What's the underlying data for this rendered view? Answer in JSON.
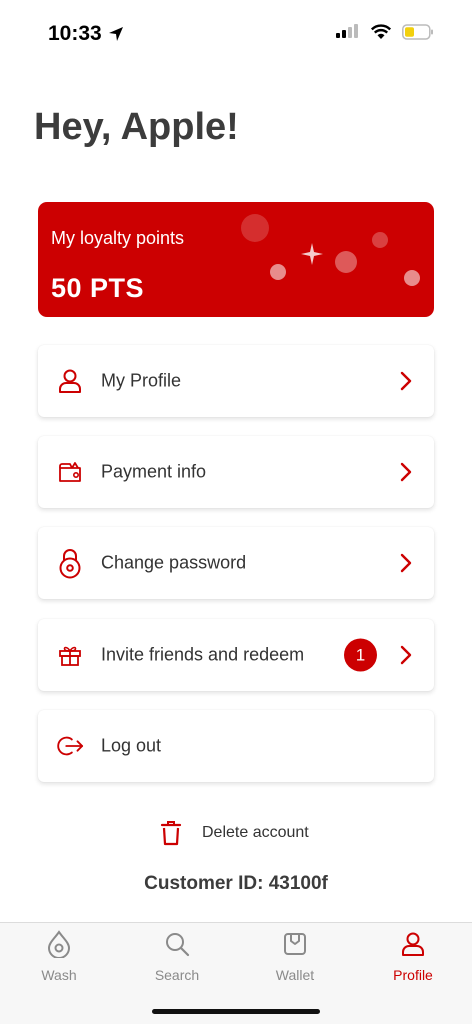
{
  "status": {
    "time": "10:33"
  },
  "greeting": "Hey, Apple!",
  "loyalty": {
    "label": "My loyalty points",
    "points": "50 PTS"
  },
  "menu": [
    {
      "label": "My Profile",
      "icon": "user-icon"
    },
    {
      "label": "Payment info",
      "icon": "wallet-icon"
    },
    {
      "label": "Change password",
      "icon": "lock-icon"
    },
    {
      "label": "Invite friends and redeem",
      "icon": "gift-icon",
      "badge": "1"
    },
    {
      "label": "Log out",
      "icon": "logout-icon"
    }
  ],
  "delete_account": "Delete account",
  "customer_id": "Customer ID: 43100f",
  "tabs": [
    {
      "label": "Wash",
      "icon": "drop-icon"
    },
    {
      "label": "Search",
      "icon": "search-icon"
    },
    {
      "label": "Wallet",
      "icon": "wallet-icon"
    },
    {
      "label": "Profile",
      "icon": "user-icon",
      "active": true
    }
  ],
  "colors": {
    "accent": "#cc0001",
    "text": "#333333",
    "inactive": "#8a8a8a"
  }
}
